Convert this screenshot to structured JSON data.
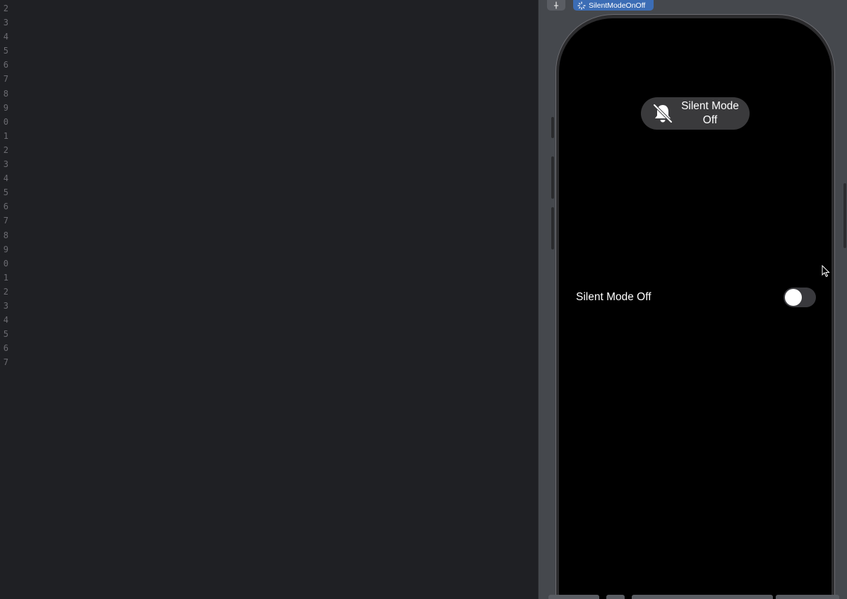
{
  "editor": {
    "line_numbers": [
      "2",
      "3",
      "4",
      "5",
      "6",
      "7",
      "8",
      "9",
      "0",
      "1",
      "2",
      "3",
      "4",
      "5",
      "6",
      "7",
      "8",
      "9",
      "0",
      "1",
      "2",
      "3",
      "4",
      "5",
      "6",
      "7"
    ]
  },
  "preview": {
    "tab_label": "SilentModeOnOff",
    "pill_text_line1": "Silent Mode",
    "pill_text_line2": "Off",
    "toggle_label": "Silent Mode Off",
    "toggle_on": false,
    "colors": {
      "canvas_bg": "#45484d",
      "tab_accent": "#3c6db5",
      "screen_bg": "#000000",
      "pill_bg": "#3a3a3c",
      "toggle_off_bg": "#39393d"
    }
  }
}
